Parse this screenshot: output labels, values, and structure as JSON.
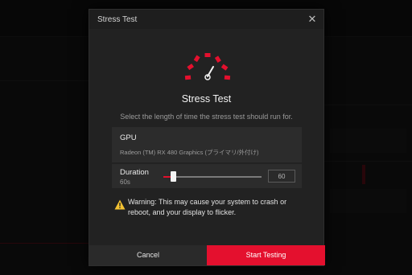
{
  "dialog": {
    "title": "Stress Test",
    "close_glyph": "✕",
    "heading": "Stress Test",
    "description": "Select the length of time the stress test should run for.",
    "icon": "speedometer-icon"
  },
  "gpu": {
    "label": "GPU",
    "value": "Radeon (TM) RX 480 Graphics (プライマリ/外付け)"
  },
  "duration": {
    "label": "Duration",
    "current": "60s",
    "input_value": "60",
    "slider_fraction": 0.1
  },
  "warning": {
    "icon": "warning-triangle-icon",
    "text": "Warning: This may cause your system to crash or reboot, and your display to flicker."
  },
  "footer": {
    "cancel_label": "Cancel",
    "start_label": "Start Testing"
  },
  "colors": {
    "accent": "#e4102e",
    "dialog_bg": "#222222",
    "row_bg": "#2c2c2c",
    "warning": "#f3c232"
  }
}
